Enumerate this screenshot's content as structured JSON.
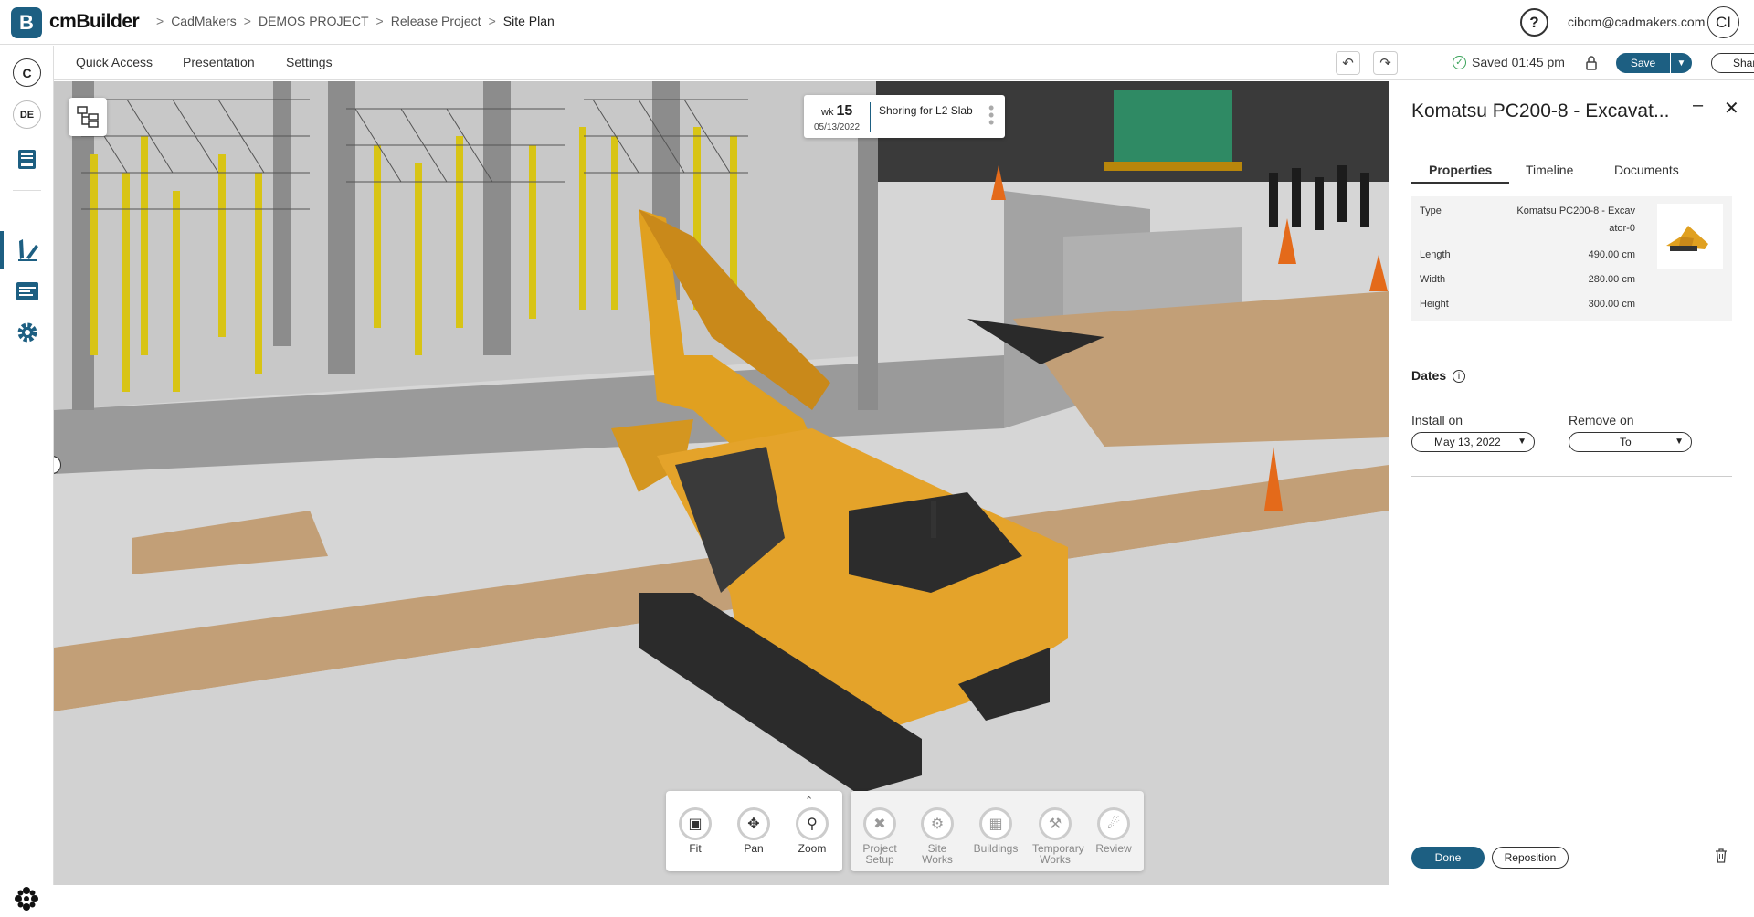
{
  "app": {
    "logo_letter": "B",
    "brand": "cmBuilder"
  },
  "breadcrumb": [
    "CadMakers",
    "DEMOS PROJECT",
    "Release Project",
    "Site Plan"
  ],
  "breadcrumb_sep": ">",
  "header": {
    "help": "?",
    "email": "cibom@cadmakers.com",
    "avatar": "CI"
  },
  "leftbar": {
    "c_label": "C",
    "de_label": "DE"
  },
  "menubar": {
    "items": [
      "Quick Access",
      "Presentation",
      "Settings"
    ],
    "saved": "Saved 01:45 pm",
    "save": "Save",
    "share": "Share"
  },
  "timeline_card": {
    "wk_label": "wk",
    "wk_number": "15",
    "date": "05/13/2022",
    "task": "Shoring for L2 Slab"
  },
  "tools": [
    {
      "label": "Fit",
      "icon": "fit-icon"
    },
    {
      "label": "Pan",
      "icon": "pan-icon"
    },
    {
      "label": "Zoom",
      "icon": "zoom-icon"
    }
  ],
  "categories": [
    {
      "label": "Project Setup",
      "line1": "Project",
      "line2": "Setup"
    },
    {
      "label": "Site Works",
      "line1": "Site Works",
      "line2": ""
    },
    {
      "label": "Buildings",
      "line1": "Buildings",
      "line2": ""
    },
    {
      "label": "Temporary Works",
      "line1": "Temporary",
      "line2": "Works"
    },
    {
      "label": "Review",
      "line1": "Review",
      "line2": ""
    }
  ],
  "panel": {
    "title": "Komatsu PC200-8 - Excavat...",
    "tabs": [
      "Properties",
      "Timeline",
      "Documents"
    ],
    "props": {
      "type_label": "Type",
      "type_value_1": "Komatsu PC200-8 - Excav",
      "type_value_2": "ator-0",
      "length_label": "Length",
      "length_value": "490.00 cm",
      "width_label": "Width",
      "width_value": "280.00 cm",
      "height_label": "Height",
      "height_value": "300.00 cm"
    },
    "dates_heading": "Dates",
    "install_label": "Install on",
    "install_value": "May 13, 2022",
    "remove_label": "Remove on",
    "remove_value": "To",
    "done": "Done",
    "reposition": "Reposition"
  },
  "colors": {
    "brand": "#1d5f82",
    "excavator": "#e0a020",
    "ground": "#c8a57f",
    "success": "#3aa35a"
  }
}
